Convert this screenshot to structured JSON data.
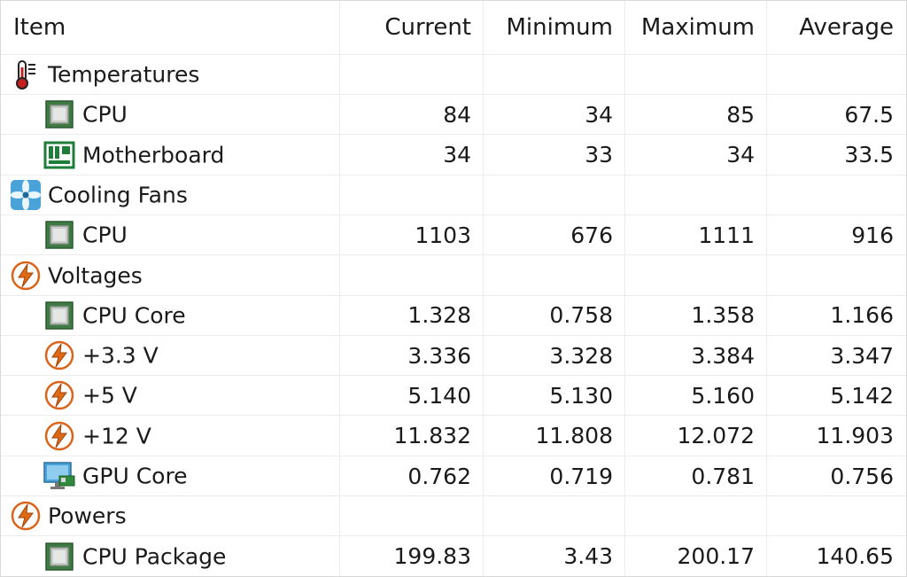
{
  "columns": {
    "item": "Item",
    "current": "Current",
    "minimum": "Minimum",
    "maximum": "Maximum",
    "average": "Average"
  },
  "rows": [
    {
      "level": 0,
      "icon": "thermometer-icon",
      "label": "Temperatures",
      "current": "",
      "minimum": "",
      "maximum": "",
      "average": ""
    },
    {
      "level": 1,
      "icon": "cpu-chip-icon",
      "label": "CPU",
      "current": "84",
      "minimum": "34",
      "maximum": "85",
      "average": "67.5"
    },
    {
      "level": 1,
      "icon": "motherboard-icon",
      "label": "Motherboard",
      "current": "34",
      "minimum": "33",
      "maximum": "34",
      "average": "33.5"
    },
    {
      "level": 0,
      "icon": "fan-icon",
      "label": "Cooling Fans",
      "current": "",
      "minimum": "",
      "maximum": "",
      "average": ""
    },
    {
      "level": 1,
      "icon": "cpu-chip-icon",
      "label": "CPU",
      "current": "1103",
      "minimum": "676",
      "maximum": "1111",
      "average": "916"
    },
    {
      "level": 0,
      "icon": "lightning-icon",
      "label": "Voltages",
      "current": "",
      "minimum": "",
      "maximum": "",
      "average": ""
    },
    {
      "level": 1,
      "icon": "cpu-chip-icon",
      "label": "CPU Core",
      "current": "1.328",
      "minimum": "0.758",
      "maximum": "1.358",
      "average": "1.166"
    },
    {
      "level": 1,
      "icon": "lightning-icon",
      "label": "+3.3 V",
      "current": "3.336",
      "minimum": "3.328",
      "maximum": "3.384",
      "average": "3.347"
    },
    {
      "level": 1,
      "icon": "lightning-icon",
      "label": "+5 V",
      "current": "5.140",
      "minimum": "5.130",
      "maximum": "5.160",
      "average": "5.142"
    },
    {
      "level": 1,
      "icon": "lightning-icon",
      "label": "+12 V",
      "current": "11.832",
      "minimum": "11.808",
      "maximum": "12.072",
      "average": "11.903"
    },
    {
      "level": 1,
      "icon": "gpu-monitor-icon",
      "label": "GPU Core",
      "current": "0.762",
      "minimum": "0.719",
      "maximum": "0.781",
      "average": "0.756"
    },
    {
      "level": 0,
      "icon": "lightning-icon",
      "label": "Powers",
      "current": "",
      "minimum": "",
      "maximum": "",
      "average": ""
    },
    {
      "level": 1,
      "icon": "cpu-chip-icon",
      "label": "CPU Package",
      "current": "199.83",
      "minimum": "3.43",
      "maximum": "200.17",
      "average": "140.65"
    }
  ]
}
